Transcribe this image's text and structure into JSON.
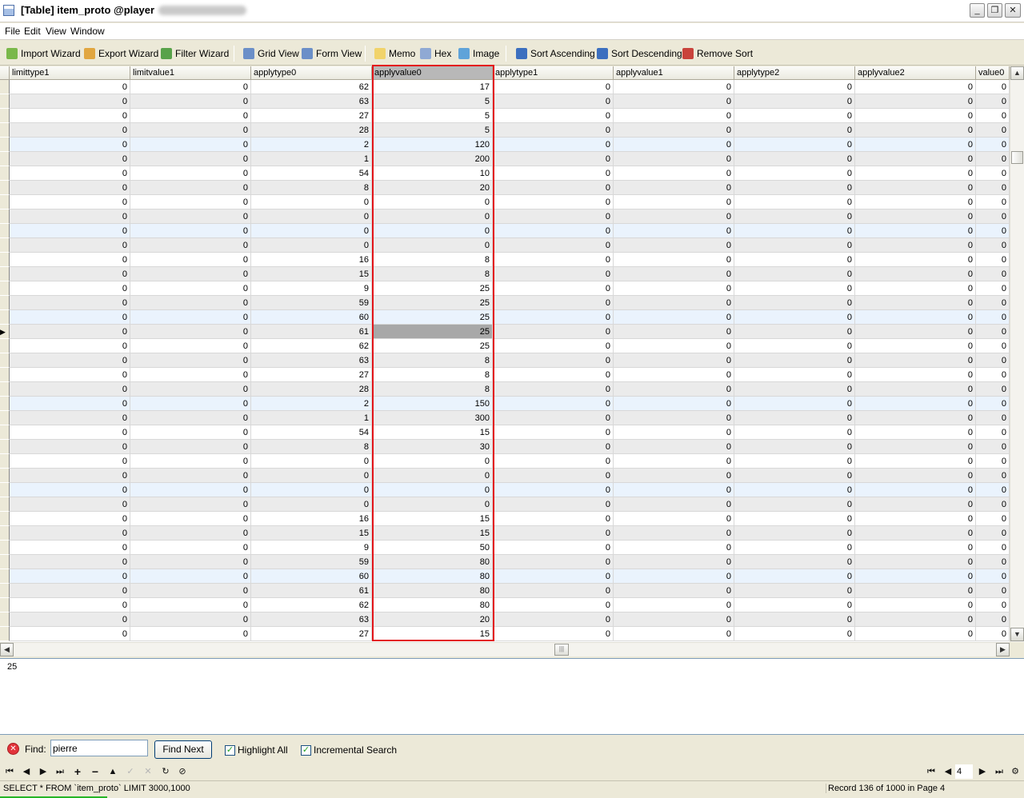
{
  "window": {
    "title": "[Table] item_proto @player"
  },
  "menu": [
    "File",
    "Edit",
    "View",
    "Window"
  ],
  "toolbar": {
    "import": "Import Wizard",
    "export": "Export Wizard",
    "filter": "Filter Wizard",
    "grid": "Grid View",
    "form": "Form View",
    "memo": "Memo",
    "hex": "Hex",
    "image": "Image",
    "sort_asc": "Sort Ascending",
    "sort_desc": "Sort Descending",
    "remove_sort": "Remove Sort"
  },
  "grid": {
    "columns": [
      "limittype1",
      "limitvalue1",
      "applytype0",
      "applyvalue0",
      "applytype1",
      "applyvalue1",
      "applytype2",
      "applyvalue2",
      "value0"
    ],
    "selected_column": "applyvalue0",
    "current_row_index": 17,
    "rows": [
      [
        "0",
        "0",
        "62",
        "17",
        "0",
        "0",
        "0",
        "0",
        "0"
      ],
      [
        "0",
        "0",
        "63",
        "5",
        "0",
        "0",
        "0",
        "0",
        "0"
      ],
      [
        "0",
        "0",
        "27",
        "5",
        "0",
        "0",
        "0",
        "0",
        "0"
      ],
      [
        "0",
        "0",
        "28",
        "5",
        "0",
        "0",
        "0",
        "0",
        "0"
      ],
      [
        "0",
        "0",
        "2",
        "120",
        "0",
        "0",
        "0",
        "0",
        "0"
      ],
      [
        "0",
        "0",
        "1",
        "200",
        "0",
        "0",
        "0",
        "0",
        "0"
      ],
      [
        "0",
        "0",
        "54",
        "10",
        "0",
        "0",
        "0",
        "0",
        "0"
      ],
      [
        "0",
        "0",
        "8",
        "20",
        "0",
        "0",
        "0",
        "0",
        "0"
      ],
      [
        "0",
        "0",
        "0",
        "0",
        "0",
        "0",
        "0",
        "0",
        "0"
      ],
      [
        "0",
        "0",
        "0",
        "0",
        "0",
        "0",
        "0",
        "0",
        "0"
      ],
      [
        "0",
        "0",
        "0",
        "0",
        "0",
        "0",
        "0",
        "0",
        "0"
      ],
      [
        "0",
        "0",
        "0",
        "0",
        "0",
        "0",
        "0",
        "0",
        "0"
      ],
      [
        "0",
        "0",
        "16",
        "8",
        "0",
        "0",
        "0",
        "0",
        "0"
      ],
      [
        "0",
        "0",
        "15",
        "8",
        "0",
        "0",
        "0",
        "0",
        "0"
      ],
      [
        "0",
        "0",
        "9",
        "25",
        "0",
        "0",
        "0",
        "0",
        "0"
      ],
      [
        "0",
        "0",
        "59",
        "25",
        "0",
        "0",
        "0",
        "0",
        "0"
      ],
      [
        "0",
        "0",
        "60",
        "25",
        "0",
        "0",
        "0",
        "0",
        "0"
      ],
      [
        "0",
        "0",
        "61",
        "25",
        "0",
        "0",
        "0",
        "0",
        "0"
      ],
      [
        "0",
        "0",
        "62",
        "25",
        "0",
        "0",
        "0",
        "0",
        "0"
      ],
      [
        "0",
        "0",
        "63",
        "8",
        "0",
        "0",
        "0",
        "0",
        "0"
      ],
      [
        "0",
        "0",
        "27",
        "8",
        "0",
        "0",
        "0",
        "0",
        "0"
      ],
      [
        "0",
        "0",
        "28",
        "8",
        "0",
        "0",
        "0",
        "0",
        "0"
      ],
      [
        "0",
        "0",
        "2",
        "150",
        "0",
        "0",
        "0",
        "0",
        "0"
      ],
      [
        "0",
        "0",
        "1",
        "300",
        "0",
        "0",
        "0",
        "0",
        "0"
      ],
      [
        "0",
        "0",
        "54",
        "15",
        "0",
        "0",
        "0",
        "0",
        "0"
      ],
      [
        "0",
        "0",
        "8",
        "30",
        "0",
        "0",
        "0",
        "0",
        "0"
      ],
      [
        "0",
        "0",
        "0",
        "0",
        "0",
        "0",
        "0",
        "0",
        "0"
      ],
      [
        "0",
        "0",
        "0",
        "0",
        "0",
        "0",
        "0",
        "0",
        "0"
      ],
      [
        "0",
        "0",
        "0",
        "0",
        "0",
        "0",
        "0",
        "0",
        "0"
      ],
      [
        "0",
        "0",
        "0",
        "0",
        "0",
        "0",
        "0",
        "0",
        "0"
      ],
      [
        "0",
        "0",
        "16",
        "15",
        "0",
        "0",
        "0",
        "0",
        "0"
      ],
      [
        "0",
        "0",
        "15",
        "15",
        "0",
        "0",
        "0",
        "0",
        "0"
      ],
      [
        "0",
        "0",
        "9",
        "50",
        "0",
        "0",
        "0",
        "0",
        "0"
      ],
      [
        "0",
        "0",
        "59",
        "80",
        "0",
        "0",
        "0",
        "0",
        "0"
      ],
      [
        "0",
        "0",
        "60",
        "80",
        "0",
        "0",
        "0",
        "0",
        "0"
      ],
      [
        "0",
        "0",
        "61",
        "80",
        "0",
        "0",
        "0",
        "0",
        "0"
      ],
      [
        "0",
        "0",
        "62",
        "80",
        "0",
        "0",
        "0",
        "0",
        "0"
      ],
      [
        "0",
        "0",
        "63",
        "20",
        "0",
        "0",
        "0",
        "0",
        "0"
      ],
      [
        "0",
        "0",
        "27",
        "15",
        "0",
        "0",
        "0",
        "0",
        "0"
      ]
    ]
  },
  "memo": {
    "value": "25"
  },
  "find": {
    "label": "Find:",
    "value": "pierre",
    "button": "Find Next",
    "highlight_all": "Highlight All",
    "incremental": "Incremental Search"
  },
  "pager": {
    "page": "4"
  },
  "status": {
    "sql": "SELECT * FROM `item_proto` LIMIT 3000,1000",
    "record": "Record 136 of 1000 in Page 4"
  },
  "colors": {
    "selection_frame": "#e3151a",
    "active_cell": "#a8a8a8",
    "row_alt": "#ebebeb",
    "row_blue": "#eaf3fd"
  }
}
